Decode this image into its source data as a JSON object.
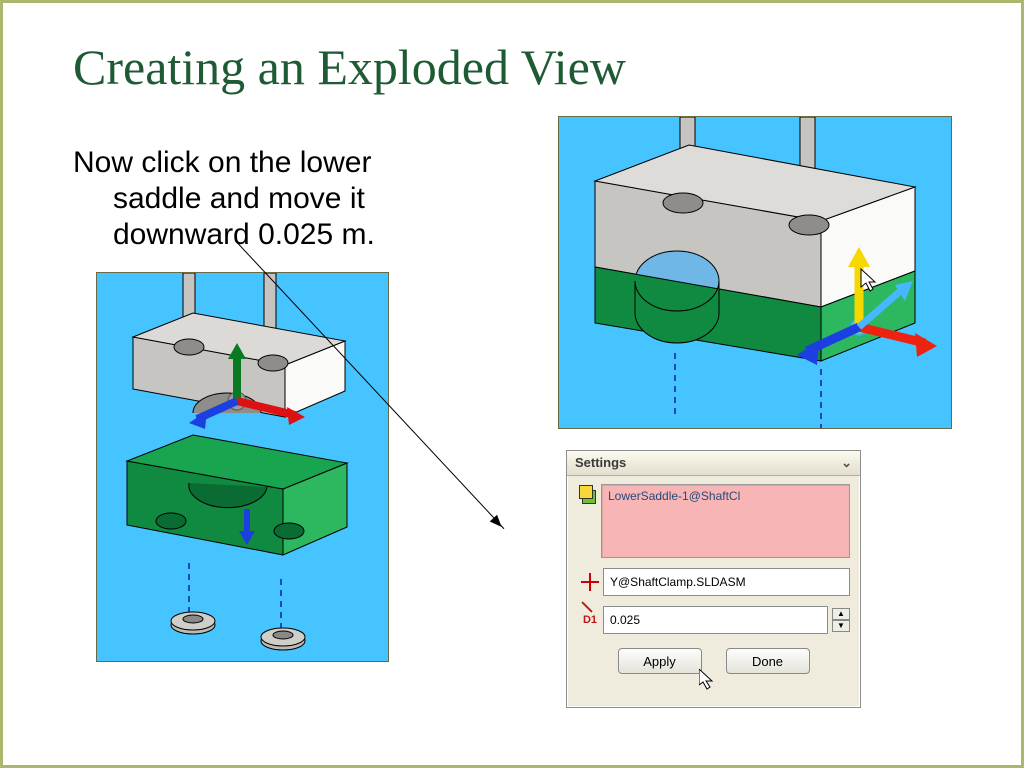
{
  "title": "Creating an Exploded View",
  "body_line1": "Now click on the lower",
  "body_line2": "saddle and move it",
  "body_line3": "downward 0.025 m.",
  "settings": {
    "header": "Settings",
    "selection": "LowerSaddle-1@ShaftCl",
    "direction_field": "Y@ShaftClamp.SLDASM",
    "distance_label": "D1",
    "distance_value": "0.025",
    "apply": "Apply",
    "done": "Done"
  }
}
